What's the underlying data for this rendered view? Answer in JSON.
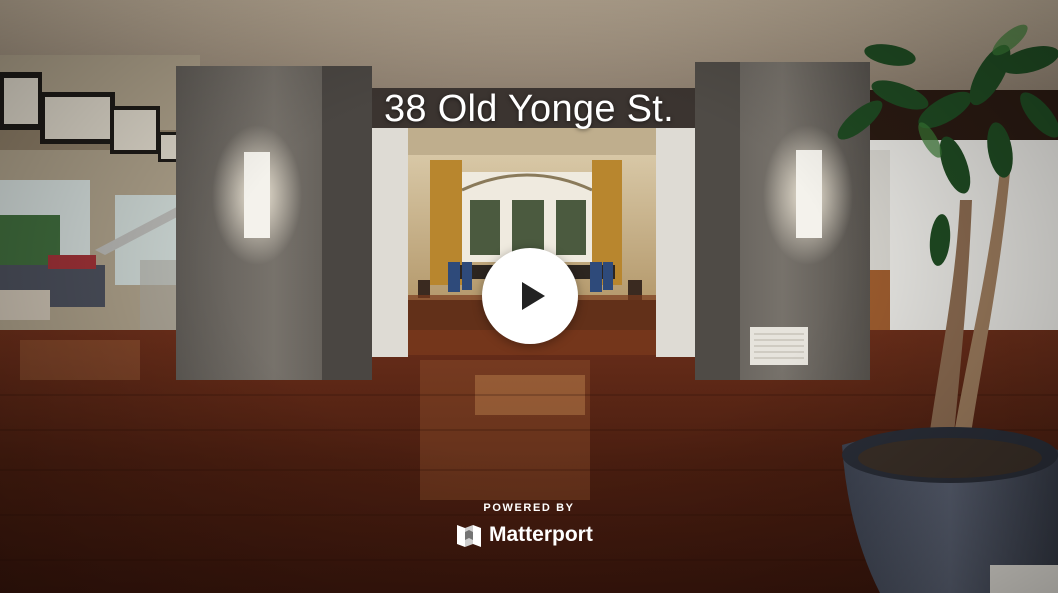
{
  "tour": {
    "title": "38 Old Yonge St.",
    "play_icon": "play-icon"
  },
  "branding": {
    "powered_by": "POWERED BY",
    "name": "Matterport",
    "logo_icon": "matterport-logo-icon"
  },
  "colors": {
    "text": "#ffffff",
    "play_button": "#ffffff",
    "play_glyph": "#222222"
  }
}
